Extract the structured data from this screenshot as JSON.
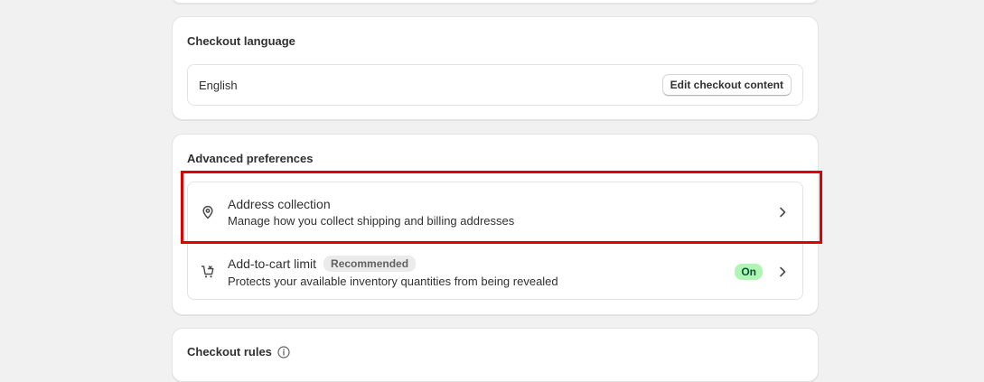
{
  "checkout_language": {
    "title": "Checkout language",
    "value": "English",
    "edit_button_label": "Edit checkout content"
  },
  "advanced_preferences": {
    "title": "Advanced preferences",
    "items": [
      {
        "icon": "location-pin-icon",
        "title": "Address collection",
        "description": "Manage how you collect shipping and billing addresses"
      },
      {
        "icon": "cart-limit-icon",
        "title": "Add-to-cart limit",
        "badge": "Recommended",
        "status": "On",
        "description": "Protects your available inventory quantities from being revealed"
      }
    ]
  },
  "checkout_rules": {
    "title": "Checkout rules",
    "icon": "info-icon"
  },
  "colors": {
    "highlight": "#e00000",
    "on_badge_bg": "#aff5b4",
    "on_badge_text": "#0c5132"
  }
}
